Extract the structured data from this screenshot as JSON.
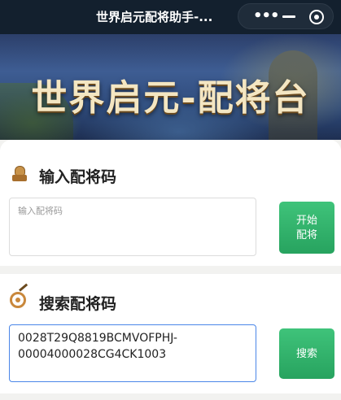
{
  "window": {
    "title": "世界启元配将助手-...",
    "capsule": {
      "more_icon": "more-dots-icon",
      "minimize_icon": "minimize-icon",
      "close_icon": "target-close-icon"
    }
  },
  "banner": {
    "title": "世界启元-配将台"
  },
  "sections": {
    "input": {
      "title": "输入配将码",
      "icon": "seal-icon",
      "placeholder": "输入配将码",
      "button_label": "开始\n配将"
    },
    "search": {
      "title": "搜索配将码",
      "icon": "target-icon",
      "value": "0028T29Q8819BCMVOFPHJ-00004000028CG4CK1003",
      "button_label": "搜索"
    }
  },
  "colors": {
    "topbar": "#13202e",
    "accent_green": "#27a35f",
    "focus_blue": "#4a86e8",
    "icon_gold": "#c9883c"
  }
}
